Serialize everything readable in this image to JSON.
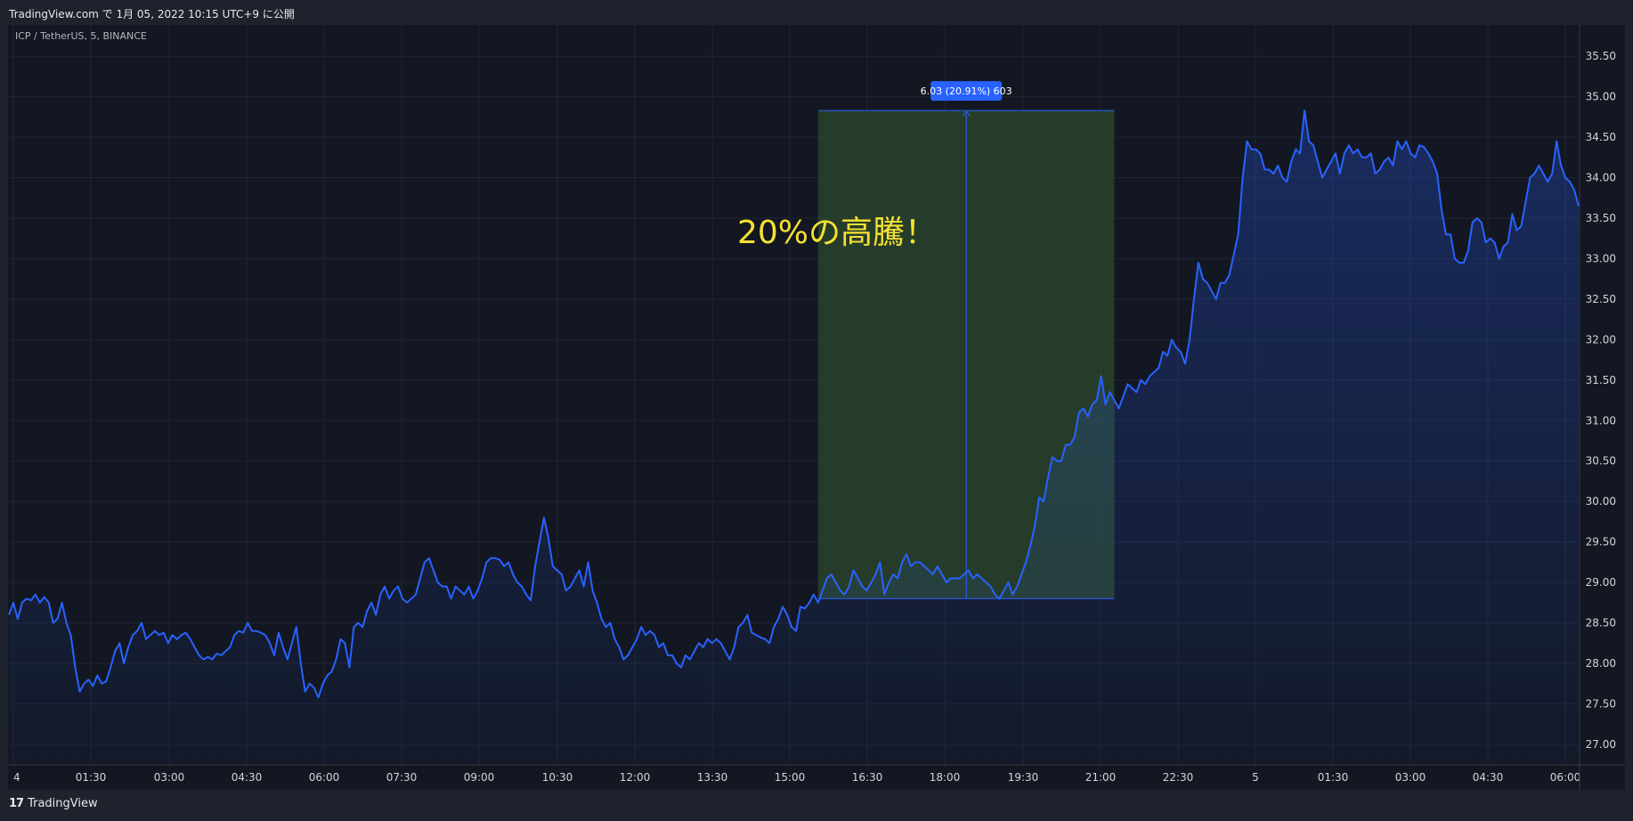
{
  "header": {
    "published": "TradingView.com で 1月 05, 2022 10:15 UTC+9 に公開"
  },
  "symbol": "ICP / TetherUS, 5, BINANCE",
  "annotation": "20%の高騰！",
  "measure_label": "6.03 (20.91%) 603",
  "footer": {
    "logo_text": "TradingView",
    "logo_glyph": "17"
  },
  "colors": {
    "line": "#2962ff",
    "measure_fill": "#2d4a2e",
    "label_bg": "#2962ff",
    "annotation": "#f5e132",
    "bg": "#131722"
  },
  "chart_data": {
    "type": "area",
    "ylim": [
      26.9,
      35.7
    ],
    "yticks": [
      "35.50",
      "35.00",
      "34.50",
      "34.00",
      "33.50",
      "33.00",
      "32.50",
      "32.00",
      "31.50",
      "31.00",
      "30.50",
      "30.00",
      "29.50",
      "29.00",
      "28.50",
      "28.00",
      "27.50",
      "27.00"
    ],
    "xticks": [
      "4",
      "01:30",
      "03:00",
      "04:30",
      "06:00",
      "07:30",
      "09:00",
      "10:30",
      "12:00",
      "13:30",
      "15:00",
      "16:30",
      "18:00",
      "19:30",
      "21:00",
      "22:30",
      "5",
      "01:30",
      "03:00",
      "04:30",
      "06:00"
    ],
    "measure": {
      "from_index": 183,
      "to_index": 250,
      "low": 28.8,
      "high": 34.83
    },
    "values": [
      28.6,
      28.75,
      28.55,
      28.75,
      28.8,
      28.78,
      28.85,
      28.75,
      28.82,
      28.75,
      28.5,
      28.55,
      28.75,
      28.5,
      28.35,
      27.95,
      27.65,
      27.75,
      27.8,
      27.72,
      27.85,
      27.75,
      27.78,
      27.95,
      28.15,
      28.25,
      28.0,
      28.2,
      28.35,
      28.4,
      28.5,
      28.3,
      28.35,
      28.4,
      28.35,
      28.38,
      28.25,
      28.35,
      28.3,
      28.35,
      28.38,
      28.3,
      28.2,
      28.1,
      28.05,
      28.08,
      28.05,
      28.12,
      28.1,
      28.15,
      28.2,
      28.35,
      28.4,
      28.38,
      28.5,
      28.4,
      28.4,
      28.38,
      28.35,
      28.25,
      28.1,
      28.38,
      28.2,
      28.05,
      28.25,
      28.45,
      28.0,
      27.65,
      27.75,
      27.7,
      27.58,
      27.75,
      27.85,
      27.9,
      28.05,
      28.3,
      28.25,
      27.95,
      28.45,
      28.5,
      28.45,
      28.65,
      28.75,
      28.6,
      28.85,
      28.95,
      28.8,
      28.9,
      28.95,
      28.8,
      28.75,
      28.8,
      28.85,
      29.05,
      29.25,
      29.3,
      29.15,
      29.0,
      28.95,
      28.95,
      28.8,
      28.95,
      28.9,
      28.85,
      28.95,
      28.8,
      28.9,
      29.05,
      29.25,
      29.3,
      29.3,
      29.28,
      29.2,
      29.25,
      29.1,
      29.0,
      28.95,
      28.85,
      28.78,
      29.2,
      29.5,
      29.8,
      29.55,
      29.2,
      29.15,
      29.1,
      28.9,
      28.95,
      29.05,
      29.15,
      28.95,
      29.25,
      28.9,
      28.75,
      28.55,
      28.45,
      28.5,
      28.3,
      28.2,
      28.05,
      28.1,
      28.2,
      28.3,
      28.45,
      28.35,
      28.4,
      28.35,
      28.2,
      28.25,
      28.1,
      28.1,
      28.0,
      27.95,
      28.1,
      28.05,
      28.15,
      28.25,
      28.2,
      28.3,
      28.25,
      28.3,
      28.25,
      28.15,
      28.05,
      28.2,
      28.45,
      28.5,
      28.6,
      28.38,
      28.35,
      28.32,
      28.3,
      28.25,
      28.45,
      28.55,
      28.7,
      28.6,
      28.45,
      28.4,
      28.7,
      28.68,
      28.75,
      28.85,
      28.75,
      28.9,
      29.05,
      29.1,
      29.0,
      28.9,
      28.85,
      28.95,
      29.15,
      29.05,
      28.95,
      28.9,
      29.0,
      29.1,
      29.25,
      28.85,
      29.0,
      29.1,
      29.05,
      29.25,
      29.35,
      29.2,
      29.25,
      29.25,
      29.2,
      29.15,
      29.1,
      29.2,
      29.1,
      29.0,
      29.05,
      29.05,
      29.05,
      29.1,
      29.15,
      29.05,
      29.1,
      29.05,
      29.0,
      28.95,
      28.85,
      28.8,
      28.9,
      29.0,
      28.85,
      28.95,
      29.1,
      29.25,
      29.45,
      29.7,
      30.05,
      30.0,
      30.3,
      30.55,
      30.5,
      30.5,
      30.7,
      30.7,
      30.8,
      31.1,
      31.15,
      31.05,
      31.2,
      31.25,
      31.55,
      31.2,
      31.35,
      31.25,
      31.15,
      31.3,
      31.45,
      31.4,
      31.35,
      31.5,
      31.45,
      31.55,
      31.6,
      31.65,
      31.85,
      31.8,
      32.0,
      31.9,
      31.85,
      31.7,
      32.0,
      32.5,
      32.95,
      32.75,
      32.7,
      32.6,
      32.5,
      32.7,
      32.7,
      32.8,
      33.05,
      33.3,
      34.0,
      34.45,
      34.35,
      34.35,
      34.3,
      34.1,
      34.1,
      34.05,
      34.15,
      34.0,
      33.95,
      34.2,
      34.35,
      34.3,
      34.83,
      34.45,
      34.4,
      34.2,
      34.0,
      34.1,
      34.2,
      34.3,
      34.05,
      34.3,
      34.4,
      34.3,
      34.35,
      34.25,
      34.25,
      34.3,
      34.05,
      34.1,
      34.2,
      34.25,
      34.15,
      34.45,
      34.35,
      34.45,
      34.3,
      34.25,
      34.4,
      34.38,
      34.3,
      34.2,
      34.05,
      33.6,
      33.3,
      33.3,
      33.0,
      32.95,
      32.95,
      33.1,
      33.45,
      33.5,
      33.45,
      33.2,
      33.25,
      33.2,
      33.0,
      33.15,
      33.2,
      33.55,
      33.35,
      33.4,
      33.7,
      34.0,
      34.05,
      34.15,
      34.05,
      33.95,
      34.05,
      34.45,
      34.15,
      34.0,
      33.95,
      33.85,
      33.65
    ]
  }
}
